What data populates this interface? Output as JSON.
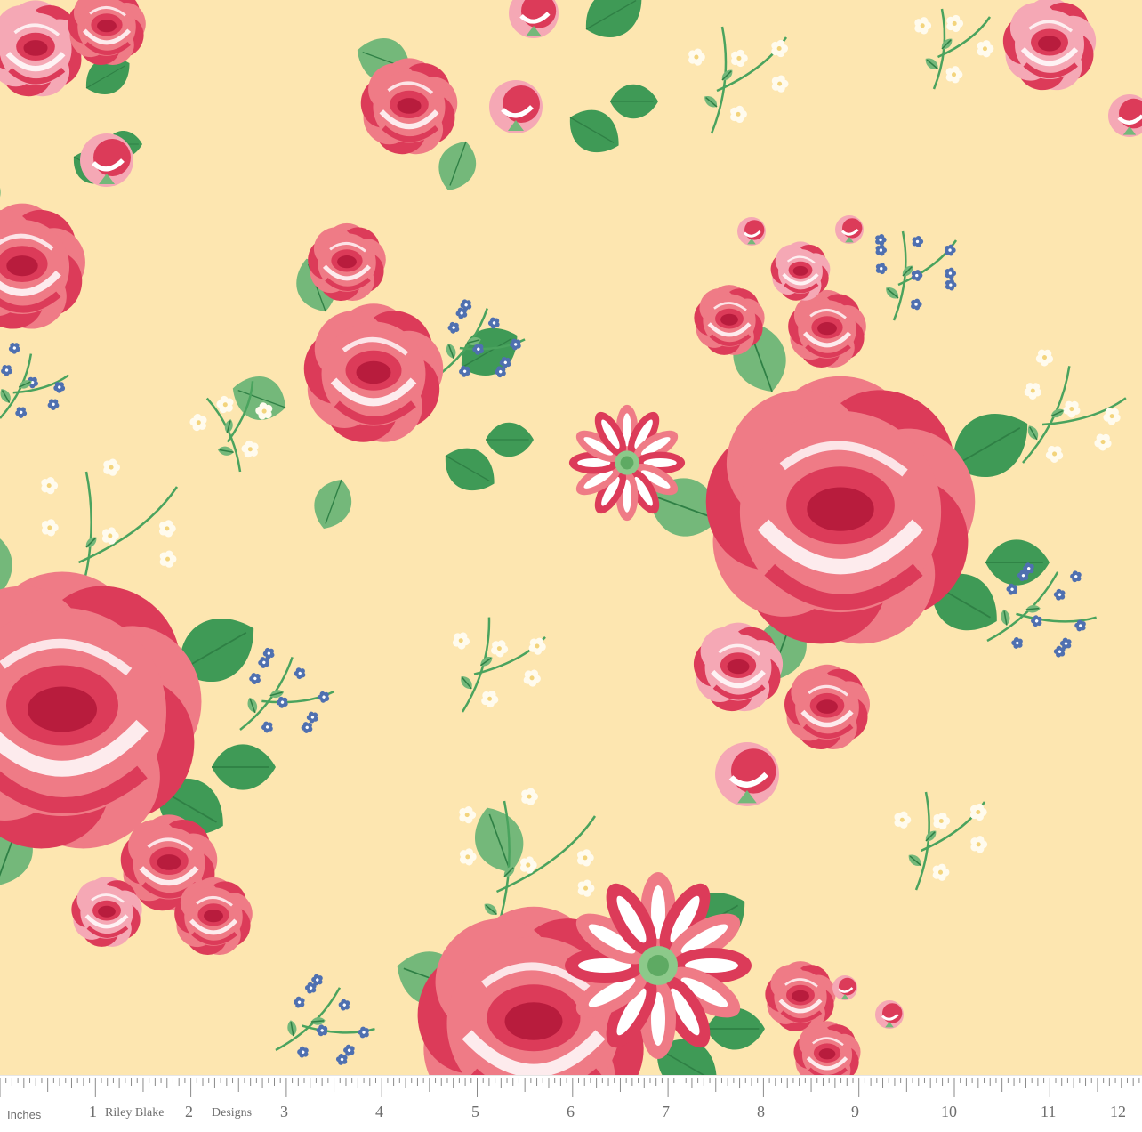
{
  "ruler": {
    "units_label": "Inches",
    "brand_left": "Riley Blake",
    "brand_right": "Designs",
    "numbers": [
      "1",
      "2",
      "3",
      "4",
      "5",
      "6",
      "7",
      "8",
      "9",
      "10",
      "11",
      "12"
    ]
  },
  "colors": {
    "background": "#fde6b0",
    "rose_pink": "#ef7b86",
    "rose_red": "#dc3b59",
    "rose_dark": "#b81c3d",
    "rose_light": "#f5a8b5",
    "leaf_green": "#74b87a",
    "leaf_dark": "#3f9a56",
    "forget_me_not": "#4f70b0",
    "white_flower": "#fffbee"
  },
  "pattern": {
    "motifs": [
      "rose-bouquet",
      "rosebud-cluster",
      "white-flower-sprig",
      "blue-forget-me-not-sprig",
      "pink-daisy"
    ]
  }
}
